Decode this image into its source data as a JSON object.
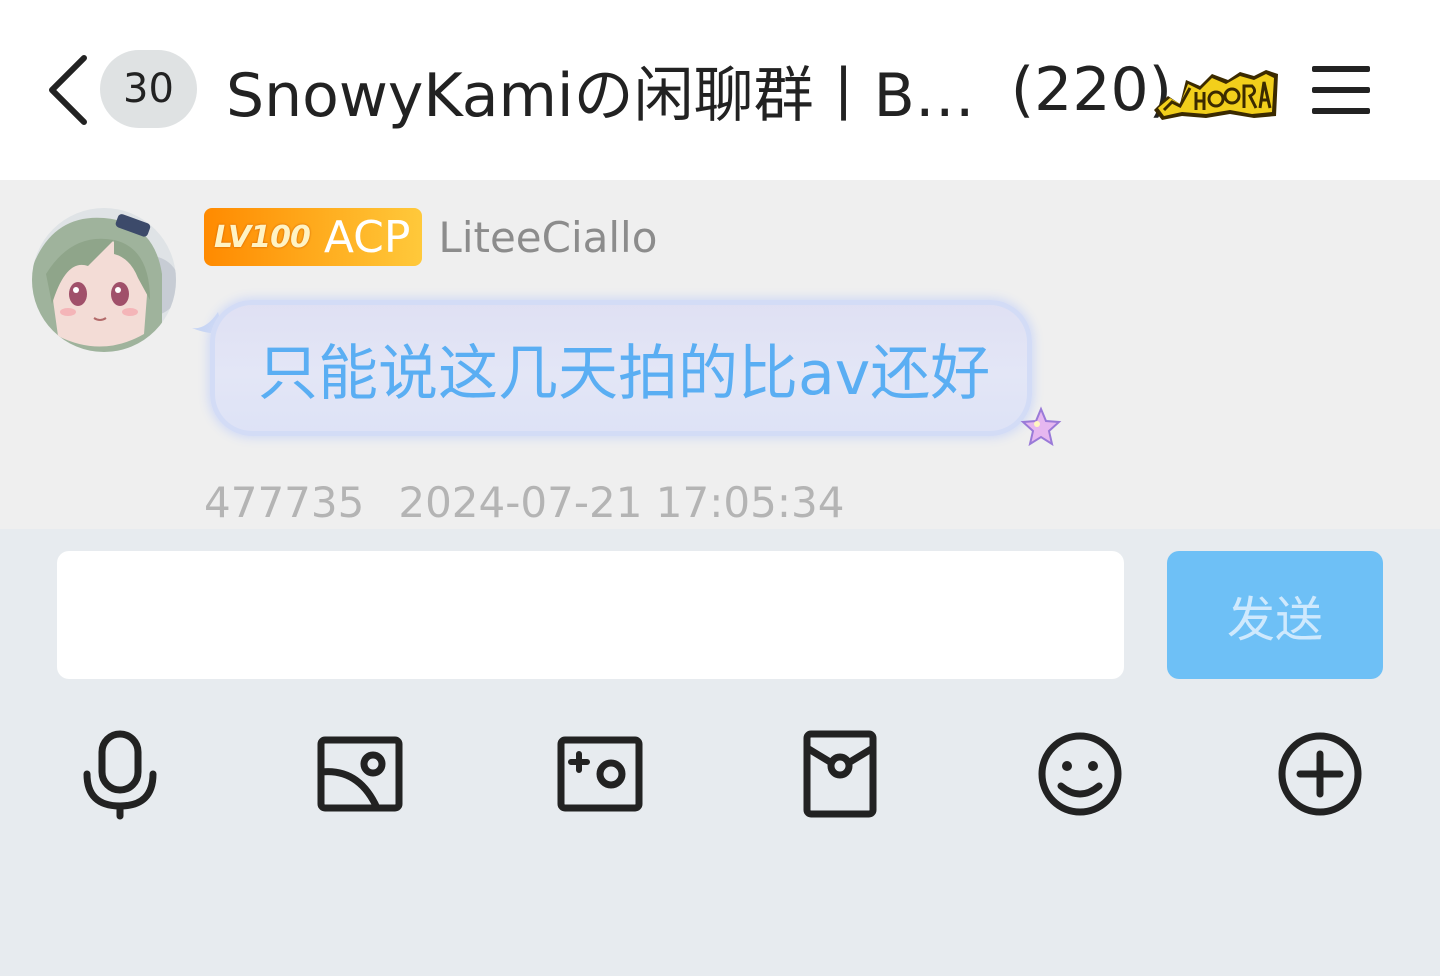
{
  "header": {
    "unread_count": "30",
    "group_title": "SnowyKamiの闲聊群丨B…",
    "member_count": "(220)"
  },
  "message": {
    "level": "LV100",
    "member_title": "ACP",
    "username": "LiteeCiallo",
    "text": "只能说这几天拍的比av还好",
    "sender_id": "477735",
    "timestamp": "2024-07-21 17:05:34"
  },
  "composer": {
    "input_value": "",
    "send_label": "发送"
  },
  "toolbar": {
    "icons": [
      "microphone-icon",
      "image-icon",
      "camera-icon",
      "red-packet-icon",
      "emoji-icon",
      "plus-icon"
    ]
  },
  "colors": {
    "bubble_text": "#5aaef3",
    "send_button": "#6ec0f6",
    "level_badge": "#ff9a0a"
  }
}
